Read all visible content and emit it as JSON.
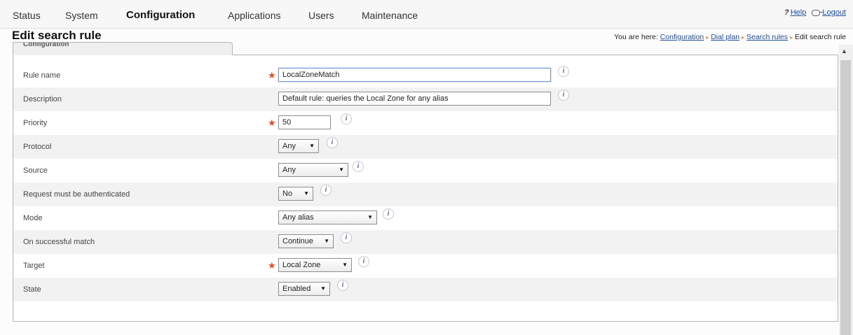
{
  "nav": {
    "items": [
      "Status",
      "System",
      "Configuration",
      "Applications",
      "Users",
      "Maintenance"
    ],
    "active": "Configuration",
    "help_icon": "?",
    "help_label": "Help",
    "logout_label": "Logout"
  },
  "page": {
    "title": "Edit search rule",
    "breadcrumb_prefix": "You are here:",
    "breadcrumb": [
      "Configuration",
      "Dial plan",
      "Search rules",
      "Edit search rule"
    ]
  },
  "section": {
    "title": "Configuration"
  },
  "fields": {
    "rule_name": {
      "label": "Rule name",
      "value": "LocalZoneMatch",
      "required": true
    },
    "description": {
      "label": "Description",
      "value": "Default rule: queries the Local Zone for any alias"
    },
    "priority": {
      "label": "Priority",
      "value": "50",
      "required": true
    },
    "protocol": {
      "label": "Protocol",
      "value": "Any"
    },
    "source": {
      "label": "Source",
      "value": "Any"
    },
    "request_auth": {
      "label": "Request must be authenticated",
      "value": "No"
    },
    "mode": {
      "label": "Mode",
      "value": "Any alias"
    },
    "on_match": {
      "label": "On successful match",
      "value": "Continue"
    },
    "target": {
      "label": "Target",
      "value": "Local Zone",
      "required": true
    },
    "state": {
      "label": "State",
      "value": "Enabled"
    }
  },
  "common": {
    "required_marker": "★",
    "info_icon": "i",
    "dropdown_arrow": "▼",
    "scroll_up": "▲",
    "crumb_separator": "▸"
  },
  "icons": {
    "help": "help-icon",
    "logout": "logout-icon",
    "info": "info-icon",
    "dropdown": "chevron-down-icon"
  },
  "colors": {
    "required": "#e34c1e",
    "link": "#1d4fa0",
    "crumb_separator": "#e08b3a"
  }
}
